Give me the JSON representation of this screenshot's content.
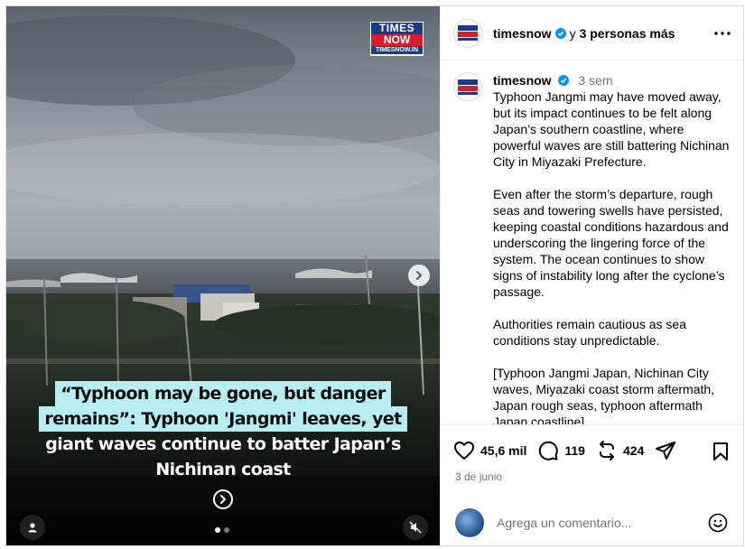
{
  "media": {
    "logo": {
      "line1": "TIMES",
      "line2": "NOW",
      "line3": "TIMESNOW.IN"
    },
    "caption": {
      "line1": "“Typhoon may be gone, but danger",
      "line2": "remains”: Typhoon 'Jangmi' leaves, yet",
      "line3": "giant waves continue to batter Japan’s",
      "line4": "Nichinan coast"
    },
    "highlight_color": "#b7eef3",
    "slide_count": 2,
    "active_slide": 1
  },
  "header": {
    "username": "timesnow",
    "collab_prefix": "y",
    "collab_text": "3 personas más"
  },
  "post": {
    "username": "timesnow",
    "time_ago": "3 sem",
    "paragraphs": [
      "Typhoon Jangmi may have moved away, but its impact continues to be felt along Japan’s southern coastline, where powerful waves are still battering Nichinan City in Miyazaki Prefecture.",
      "Even after the storm’s departure, rough seas and towering swells have persisted, keeping coastal conditions hazardous and underscoring the lingering force of the system. The ocean continues to show signs of instability long after the cyclone’s passage.",
      "Authorities remain cautious as sea conditions stay unpredictable.",
      "[Typhoon Jangmi Japan, Nichinan City waves, Miyazaki coast storm aftermath, Japan rough seas, typhoon aftermath Japan coastline]"
    ]
  },
  "actions": {
    "likes": "45,6 mil",
    "comments": "119",
    "reposts": "424",
    "date": "3 de junio"
  },
  "comment_box": {
    "placeholder": "Agrega un comentario..."
  },
  "colors": {
    "verified": "#0095f6",
    "secondary_text": "#737373",
    "border": "#dbdbdb"
  }
}
